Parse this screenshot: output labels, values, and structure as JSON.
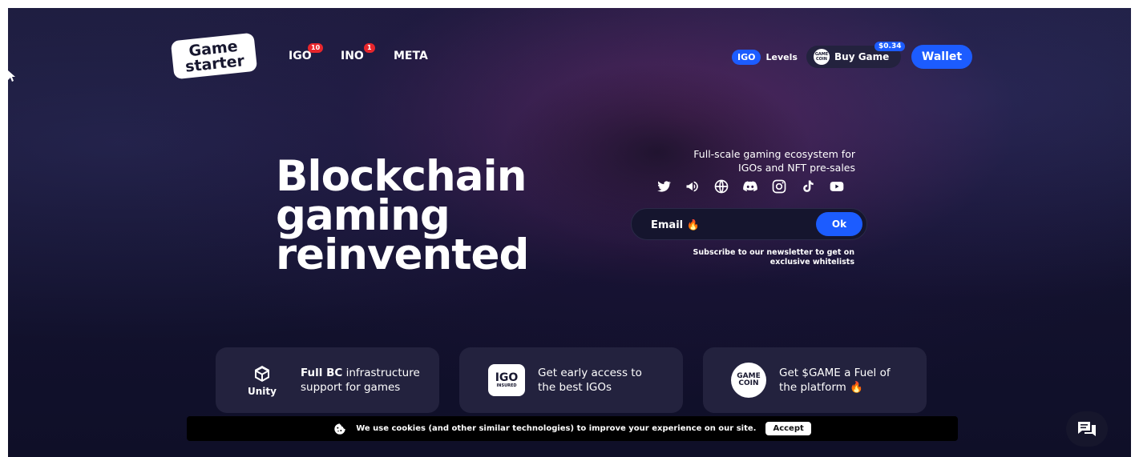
{
  "header": {
    "logo_line1": "Game",
    "logo_line2": "starter",
    "nav": [
      {
        "label": "IGO",
        "badge": "10"
      },
      {
        "label": "INO",
        "badge": "1"
      },
      {
        "label": "META",
        "badge": ""
      }
    ],
    "igo_levels_pill": "IGO",
    "igo_levels_label": "Levels",
    "buy_game_label": "Buy Game",
    "buy_game_coin": "GAME COIN",
    "game_price": "$0.34",
    "wallet_label": "Wallet"
  },
  "hero": {
    "title_line1": "Blockchain",
    "title_line2": "gaming",
    "title_line3": "reinvented",
    "tagline_line1": "Full-scale gaming ecosystem for",
    "tagline_line2": "IGOs and NFT pre-sales",
    "socials": [
      "twitter-icon",
      "megaphone-icon",
      "globe-icon",
      "discord-icon",
      "instagram-icon",
      "tiktok-icon",
      "youtube-icon"
    ],
    "email_placeholder": "Email 🔥",
    "ok_label": "Ok",
    "subscribe_line1": "Subscribe to our newsletter to get on",
    "subscribe_line2": "exclusive whitelists"
  },
  "cards": [
    {
      "icon_label": "Unity",
      "bold": "Full BC",
      "text1": " infrastructure",
      "text2": "support for games"
    },
    {
      "icon_top": "IGO",
      "icon_bottom": "INSURED",
      "text1": "Get early access to",
      "text2": "the best IGOs"
    },
    {
      "icon_top": "GAME",
      "icon_bottom": "COIN",
      "text1": "Get $GAME a Fuel of",
      "text2": "the platform 🔥"
    }
  ],
  "cookie": {
    "text": "We use cookies (and other similar technologies) to improve your experience on our site.",
    "accept_label": "Accept"
  },
  "colors": {
    "accent_blue": "#1c5cff",
    "badge_red": "#e8262c",
    "card_bg": "#23223e"
  }
}
